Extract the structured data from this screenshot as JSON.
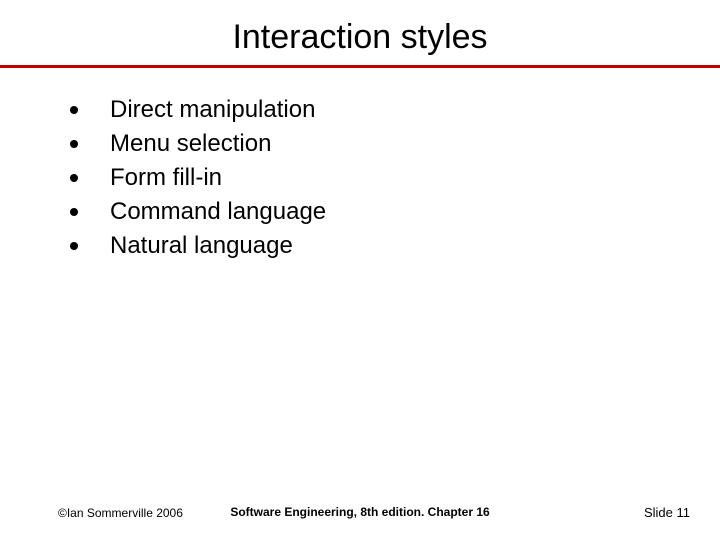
{
  "title": "Interaction styles",
  "bullets": {
    "0": "Direct manipulation",
    "1": "Menu selection",
    "2": "Form fill-in",
    "3": "Command language",
    "4": "Natural language"
  },
  "footer": {
    "copyright": "©Ian Sommerville 2006",
    "center": "Software Engineering, 8th edition. Chapter 16",
    "slide": "Slide 11"
  }
}
